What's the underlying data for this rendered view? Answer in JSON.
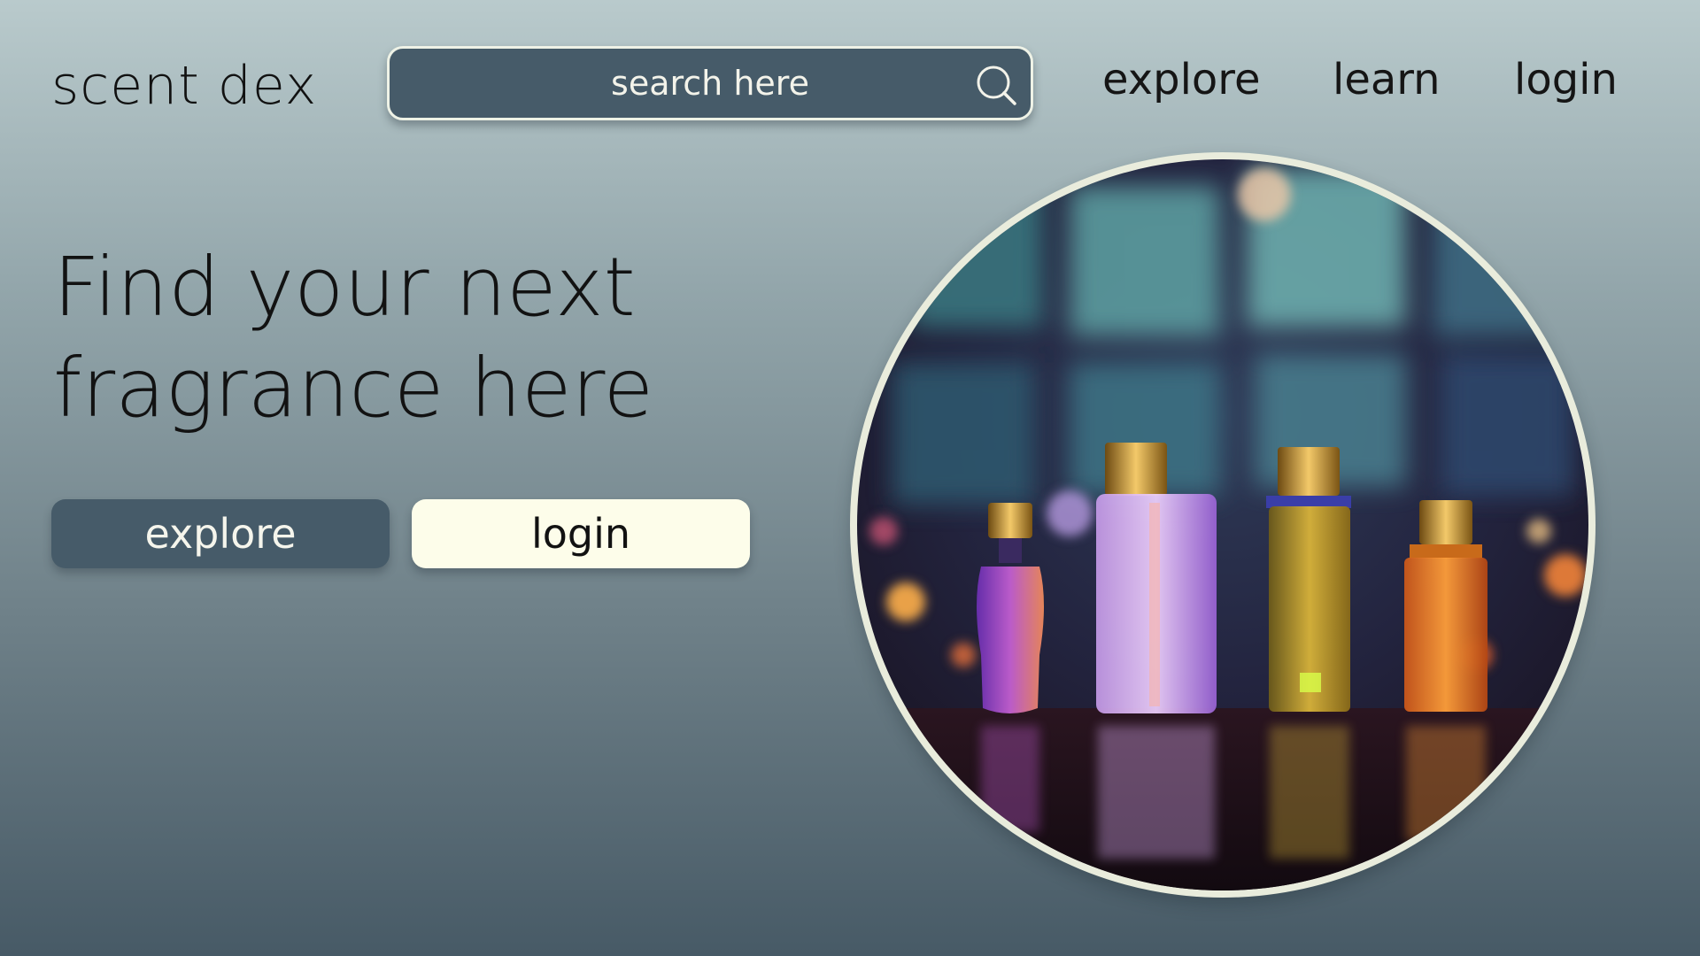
{
  "header": {
    "logo": "scent dex",
    "search": {
      "placeholder": "search here"
    },
    "nav": [
      {
        "label": "explore"
      },
      {
        "label": "learn"
      },
      {
        "label": "login"
      }
    ]
  },
  "hero": {
    "headline_line1": "Find your next",
    "headline_line2": "fragrance here",
    "buttons": {
      "explore": "explore",
      "login": "login"
    },
    "image": "perfume-bottles-photo"
  },
  "colors": {
    "primary": "#465b69",
    "cream": "#fdfdea",
    "text": "#121212"
  }
}
